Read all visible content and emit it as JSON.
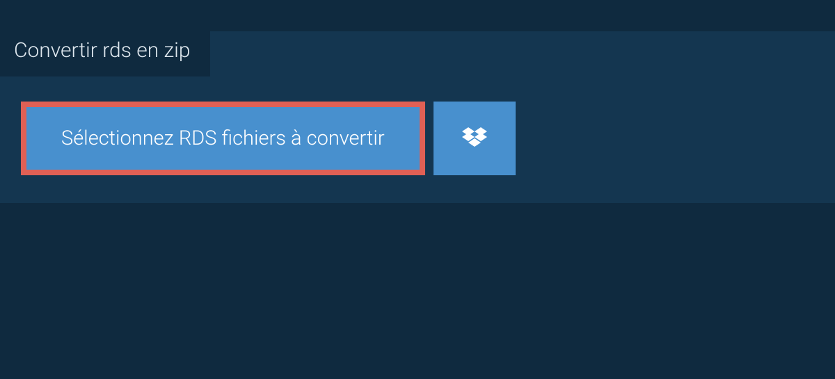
{
  "header": {
    "tab_title": "Convertir rds en zip"
  },
  "actions": {
    "select_files_label": "Sélectionnez RDS fichiers à convertir"
  },
  "colors": {
    "background": "#0f2a3f",
    "panel": "#143650",
    "button": "#4890ce",
    "highlight_border": "#e06055",
    "text_light": "#dfe8ef"
  }
}
